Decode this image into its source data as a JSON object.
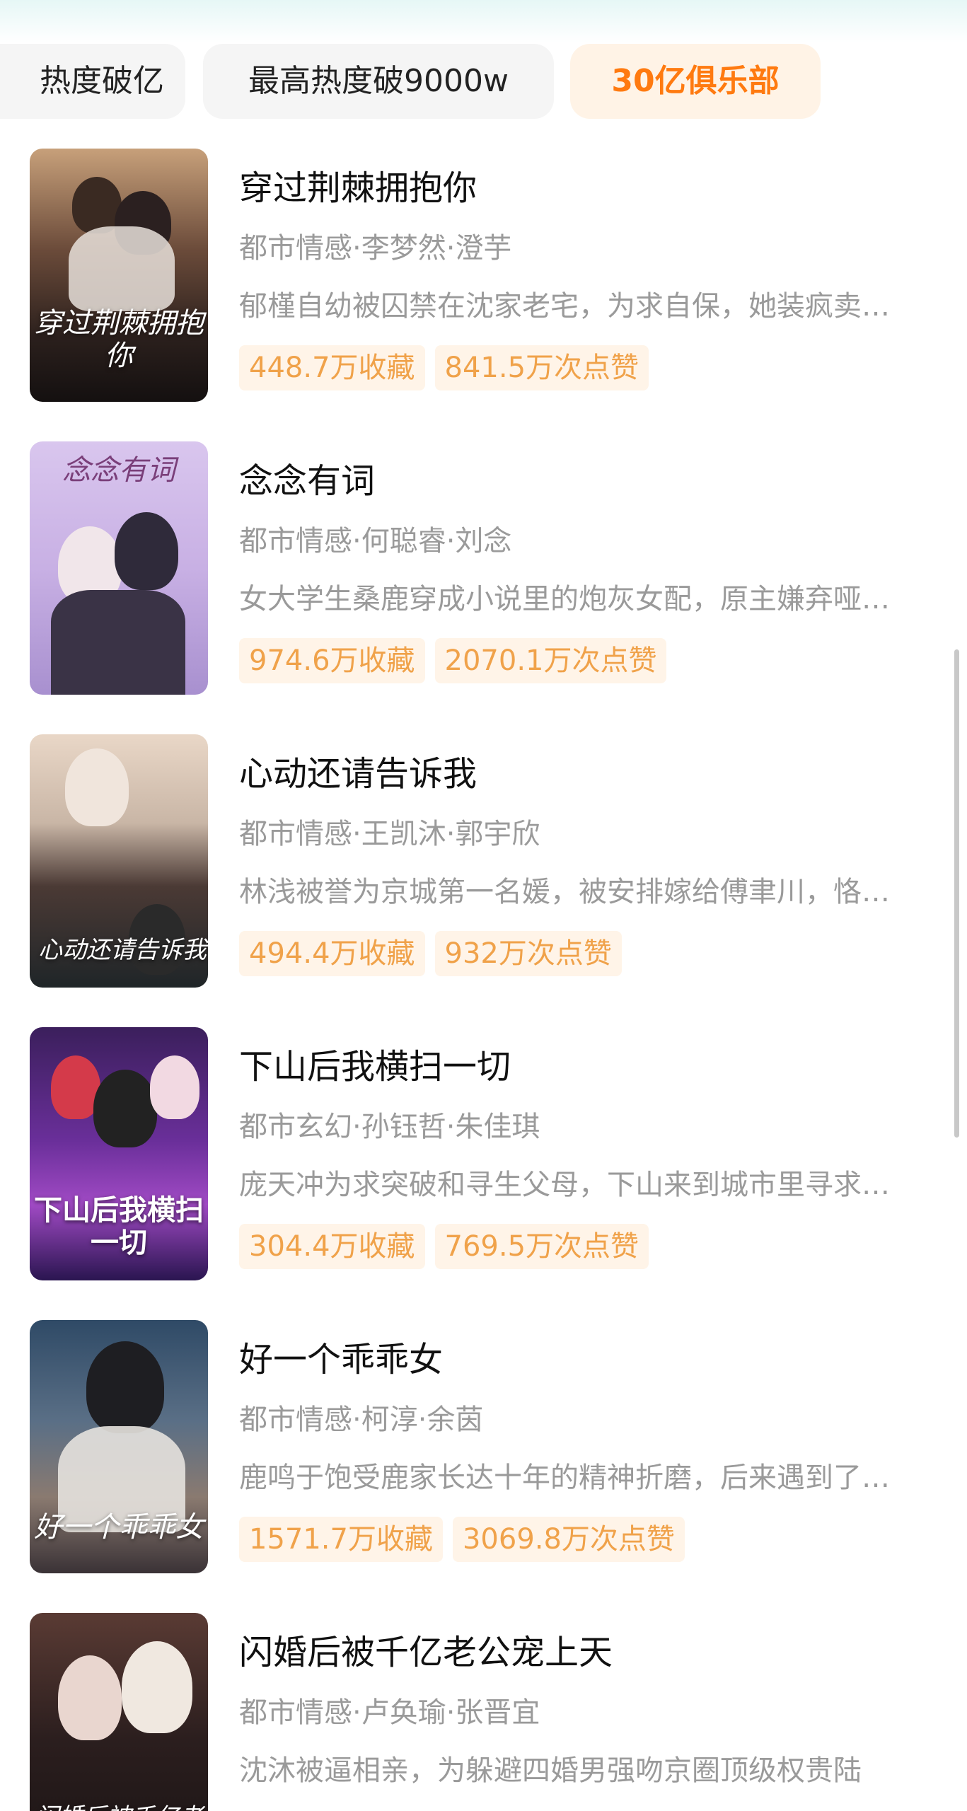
{
  "filters": [
    {
      "label": "热度破亿",
      "active": false
    },
    {
      "label": "最高热度破9000w",
      "active": false
    },
    {
      "label": "30亿俱乐部",
      "active": true
    }
  ],
  "items": [
    {
      "title": "穿过荆棘拥抱你",
      "meta": "都市情感·李梦然·澄芋",
      "desc": "郁槿自幼被囚禁在沈家老宅，为求自保，她装疯卖…",
      "favorites": "448.7万收藏",
      "likes": "841.5万次点赞",
      "poster_text": "穿过荆棘拥抱你"
    },
    {
      "title": "念念有词",
      "meta": "都市情感·何聪睿·刘念",
      "desc": "女大学生桑鹿穿成小说里的炮灰女配，原主嫌弃哑…",
      "favorites": "974.6万收藏",
      "likes": "2070.1万次点赞",
      "poster_text": "念念有词"
    },
    {
      "title": "心动还请告诉我",
      "meta": "都市情感·王凯沐·郭宇欣",
      "desc": "林浅被誉为京城第一名媛，被安排嫁给傅聿川，恪…",
      "favorites": "494.4万收藏",
      "likes": "932万次点赞",
      "poster_text": "心动还请告诉我"
    },
    {
      "title": "下山后我横扫一切",
      "meta": "都市玄幻·孙钰哲·朱佳琪",
      "desc": "庞天冲为求突破和寻生父母，下山来到城市里寻求…",
      "favorites": "304.4万收藏",
      "likes": "769.5万次点赞",
      "poster_text": "下山后我横扫一切"
    },
    {
      "title": "好一个乖乖女",
      "meta": "都市情感·柯淳·余茵",
      "desc": "鹿鸣于饱受鹿家长达十年的精神折磨，后来遇到了…",
      "favorites": "1571.7万收藏",
      "likes": "3069.8万次点赞",
      "poster_text": "好一个乖乖女"
    },
    {
      "title": "闪婚后被千亿老公宠上天",
      "meta": "都市情感·卢奂瑜·张晋宜",
      "desc": "沈沐被逼相亲，为躲避四婚男强吻京圈顶级权贵陆",
      "favorites": "",
      "likes": "",
      "poster_text": "闪婚后被千亿老公"
    }
  ],
  "colors": {
    "accent": "#ff7a10",
    "badge_text": "#f0a24a",
    "badge_bg": "#fff4e8"
  }
}
